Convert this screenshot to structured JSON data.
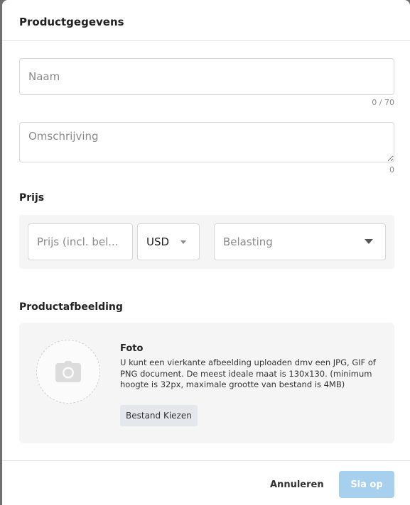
{
  "header": {
    "title": "Productgegevens"
  },
  "name": {
    "placeholder": "Naam",
    "value": "",
    "counter": "0 / 70"
  },
  "description": {
    "placeholder": "Omschrijving",
    "value": "",
    "counter": "0"
  },
  "price": {
    "section_title": "Prijs",
    "input_placeholder": "Prijs (incl. bel...",
    "currency": "USD",
    "tax_placeholder": "Belasting"
  },
  "image": {
    "section_title": "Productafbeelding",
    "heading": "Foto",
    "description": "U kunt een vierkante afbeelding uploaden dmv een JPG, GIF of PNG document. De meest ideale maat is 130x130. (minimum hoogte is 32px, maximale grootte van bestand is 4MB)",
    "choose_label": "Bestand Kiezen",
    "icon": "camera-icon"
  },
  "footer": {
    "cancel_label": "Annuleren",
    "save_label": "Sla op"
  },
  "colors": {
    "save_button_bg": "#a6d0ee",
    "panel_bg": "#f5f5f5",
    "overlay": "#6f6f6f"
  }
}
